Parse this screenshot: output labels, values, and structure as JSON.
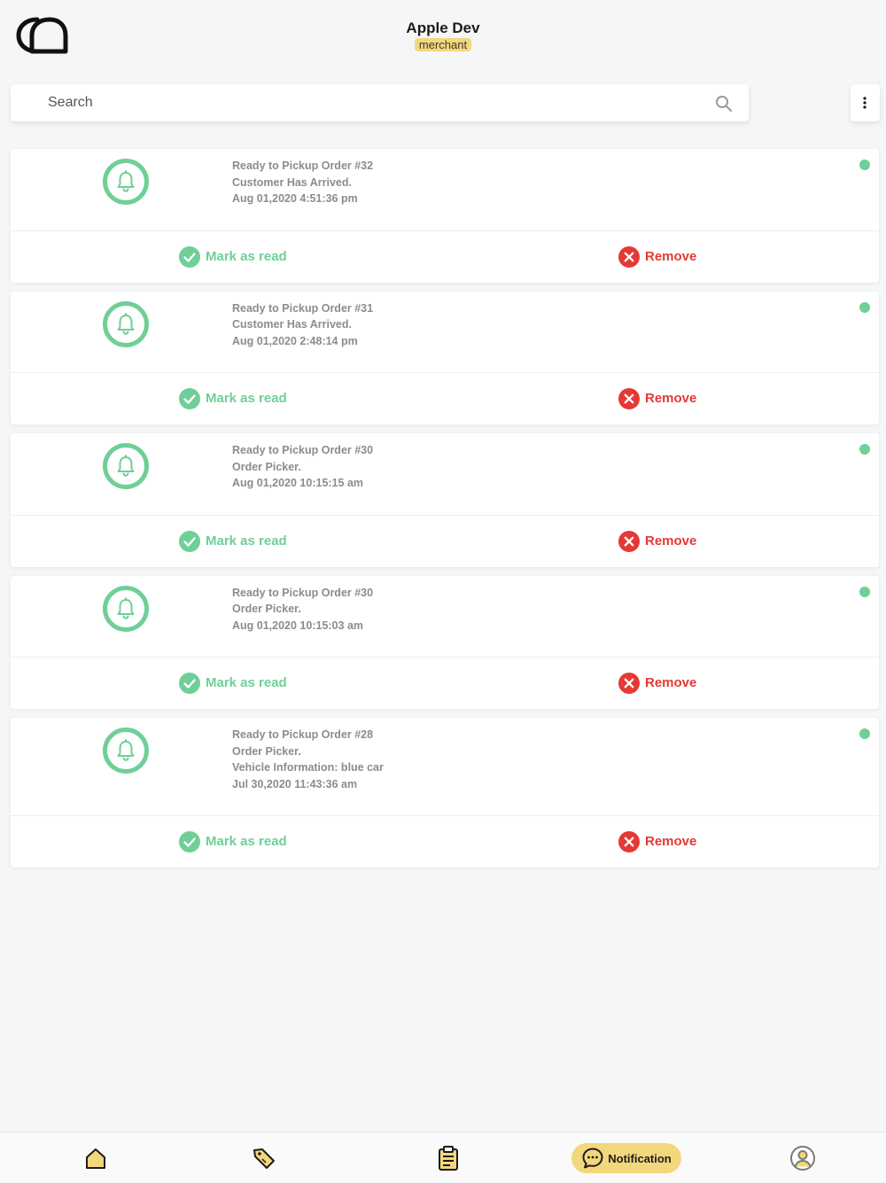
{
  "header": {
    "store_name": "Apple Dev",
    "role_badge": "merchant"
  },
  "search": {
    "placeholder": "Search"
  },
  "colors": {
    "accent_green": "#6fcf97",
    "remove_red": "#e53935",
    "badge_yellow": "#f3d77c"
  },
  "actions": {
    "mark_as_read_label": "Mark as read",
    "remove_label": "Remove"
  },
  "notifications": [
    {
      "lines": [
        "Ready to Pickup Order #32",
        "Customer Has Arrived.",
        "Aug 01,2020 4:51:36 pm"
      ],
      "unread": true
    },
    {
      "lines": [
        "Ready to Pickup Order #31",
        "Customer Has Arrived.",
        "Aug 01,2020 2:48:14 pm"
      ],
      "unread": true
    },
    {
      "lines": [
        "Ready to Pickup Order #30",
        "Order Picker.",
        "Aug 01,2020 10:15:15 am"
      ],
      "unread": true
    },
    {
      "lines": [
        "Ready to Pickup Order #30",
        "Order Picker.",
        "Aug 01,2020 10:15:03 am"
      ],
      "unread": true
    },
    {
      "lines": [
        "Ready to Pickup Order #28",
        "Order Picker.",
        "Vehicle Information: blue car",
        "Jul 30,2020 11:43:36 am"
      ],
      "unread": true
    }
  ],
  "bottom_nav": {
    "items": [
      {
        "icon": "home-icon"
      },
      {
        "icon": "tag-icon"
      },
      {
        "icon": "clipboard-icon"
      },
      {
        "icon": "chat-bubble-icon",
        "label": "Notification",
        "active": true
      },
      {
        "icon": "user-icon"
      }
    ]
  }
}
